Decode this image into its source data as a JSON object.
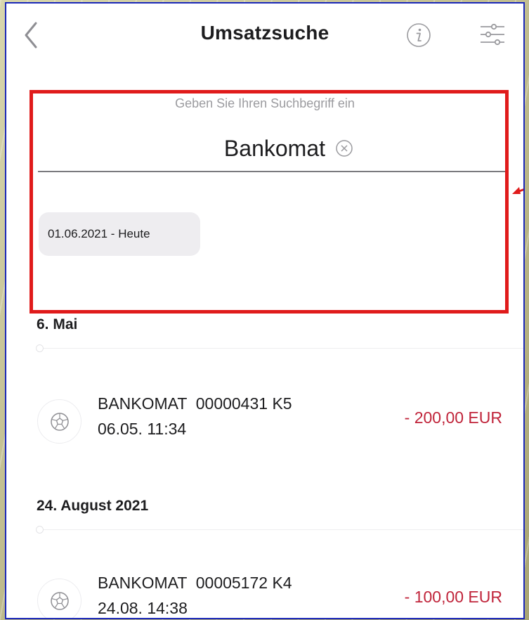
{
  "header": {
    "title": "Umsatzsuche",
    "back_icon": "chevron-left-icon",
    "info_icon": "info-icon",
    "filter_icon": "sliders-icon"
  },
  "search": {
    "hint": "Geben Sie Ihren Suchbegriff ein",
    "value": "Bankomat",
    "clear_icon": "clear-circle-icon"
  },
  "filter": {
    "date_range": "01.06.2021 - Heute"
  },
  "sections": [
    {
      "header": "6. Mai",
      "transactions": [
        {
          "title": "BANKOMAT  00000431 K5",
          "date": "06.05. 11:34",
          "amount": "- 200,00 EUR"
        }
      ]
    },
    {
      "header": "24. August 2021",
      "transactions": [
        {
          "title": "BANKOMAT  00005172 K4",
          "date": "24.08. 14:38",
          "amount": "- 100,00 EUR"
        }
      ]
    }
  ],
  "colors": {
    "highlight": "#e01b1b",
    "amount_negative": "#c0243a",
    "frame": "#1a27b8"
  }
}
